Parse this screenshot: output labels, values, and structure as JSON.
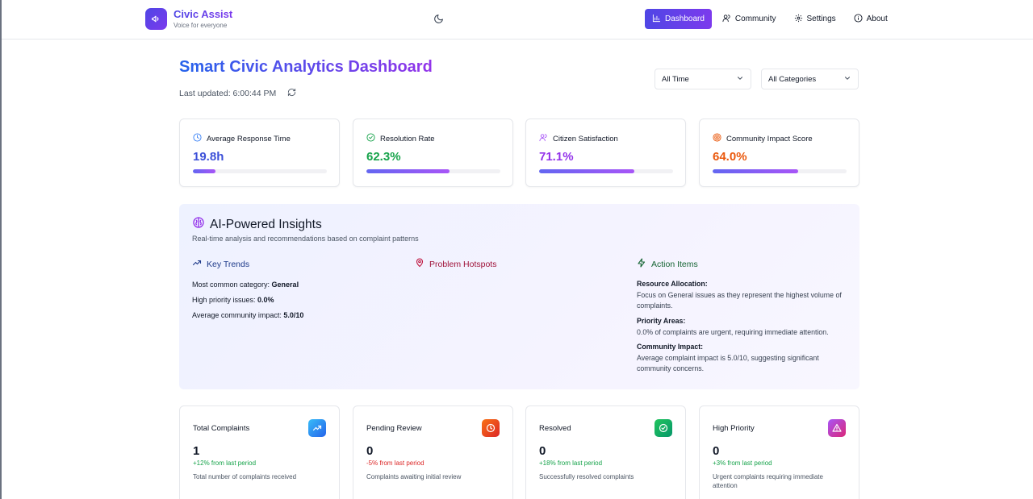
{
  "brand": {
    "title": "Civic Assist",
    "subtitle": "Voice for everyone",
    "logo_icon": "megaphone-icon"
  },
  "theme_toggle_icon": "moon-icon",
  "nav": [
    {
      "label": "Dashboard",
      "icon": "bar-chart-icon",
      "active": true
    },
    {
      "label": "Community",
      "icon": "users-icon",
      "active": false
    },
    {
      "label": "Settings",
      "icon": "gear-icon",
      "active": false
    },
    {
      "label": "About",
      "icon": "info-icon",
      "active": false
    }
  ],
  "page": {
    "title": "Smart Civic Analytics Dashboard",
    "last_updated": "Last updated: 6:00:44 PM"
  },
  "filters": {
    "time": "All Time",
    "category": "All Categories"
  },
  "metrics": [
    {
      "label": "Average Response Time",
      "value": "19.8h",
      "color": "#3b4fd8",
      "icon": "clock-icon",
      "progress": 0.17
    },
    {
      "label": "Resolution Rate",
      "value": "62.3%",
      "color": "#16a34a",
      "icon": "check-circle-icon",
      "progress": 0.623
    },
    {
      "label": "Citizen Satisfaction",
      "value": "71.1%",
      "color": "#9333ea",
      "icon": "users-icon",
      "progress": 0.711
    },
    {
      "label": "Community Impact Score",
      "value": "64.0%",
      "color": "#ea580c",
      "icon": "target-icon",
      "progress": 0.64
    }
  ],
  "insights": {
    "title": "AI-Powered Insights",
    "subtitle": "Real-time analysis and recommendations based on complaint patterns",
    "trends": {
      "heading": "Key Trends",
      "lines": [
        {
          "label": "Most common category: ",
          "value": "General"
        },
        {
          "label": "High priority issues: ",
          "value": "0.0%"
        },
        {
          "label": "Average community impact: ",
          "value": "5.0/10"
        }
      ]
    },
    "hotspots": {
      "heading": "Problem Hotspots"
    },
    "actions": {
      "heading": "Action Items",
      "items": [
        {
          "title": "Resource Allocation:",
          "text": "Focus on General issues as they represent the highest volume of complaints."
        },
        {
          "title": "Priority Areas:",
          "text": "0.0% of complaints are urgent, requiring immediate attention."
        },
        {
          "title": "Community Impact:",
          "text": "Average complaint impact is 5.0/10, suggesting significant community concerns."
        }
      ]
    },
    "colors": {
      "trends": "#1e3a8a",
      "hotspots": "#9f1239",
      "actions": "#166534"
    }
  },
  "stats": [
    {
      "label": "Total Complaints",
      "value": "1",
      "change": "+12% from last period",
      "change_color": "#16a34a",
      "desc": "Total number of complaints received",
      "icon": "trending-up-icon",
      "icon_bg": "linear-gradient(135deg,#38bdf8,#2563eb)"
    },
    {
      "label": "Pending Review",
      "value": "0",
      "change": "-5% from last period",
      "change_color": "#dc2626",
      "desc": "Complaints awaiting initial review",
      "icon": "clock-icon",
      "icon_bg": "linear-gradient(135deg,#f97316,#dc2626)"
    },
    {
      "label": "Resolved",
      "value": "0",
      "change": "+18% from last period",
      "change_color": "#16a34a",
      "desc": "Successfully resolved complaints",
      "icon": "check-circle-icon",
      "icon_bg": "linear-gradient(135deg,#22c55e,#059669)"
    },
    {
      "label": "High Priority",
      "value": "0",
      "change": "+3% from last period",
      "change_color": "#16a34a",
      "desc": "Urgent complaints requiring immediate attention",
      "icon": "alert-triangle-icon",
      "icon_bg": "linear-gradient(135deg,#a855f7,#db2777)"
    }
  ]
}
